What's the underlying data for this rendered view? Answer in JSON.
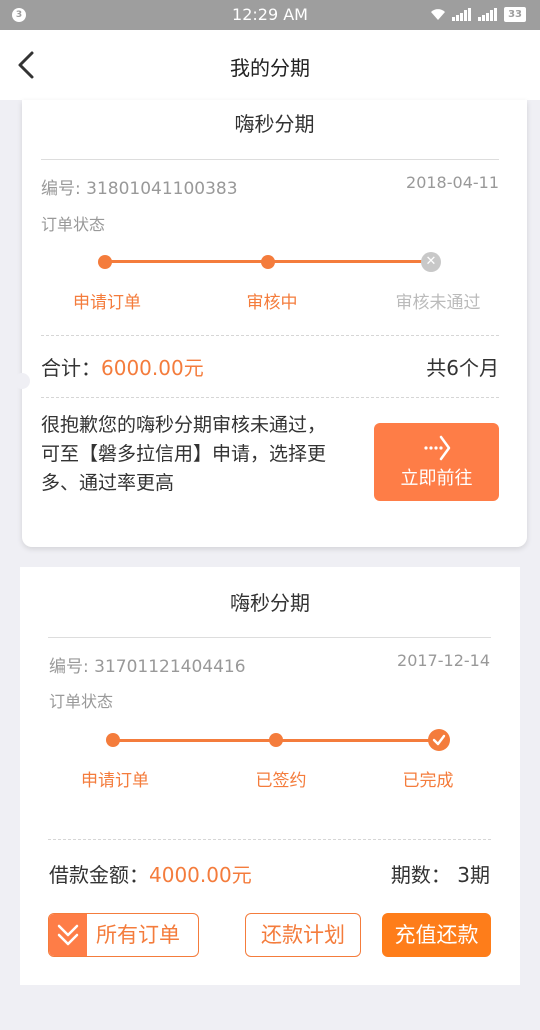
{
  "status_bar": {
    "notification_count": "3",
    "time": "12:29 AM",
    "battery": "33",
    "icons": [
      "wifi-icon",
      "signal-icon",
      "signal-icon",
      "battery-icon"
    ]
  },
  "header": {
    "title": "我的分期",
    "back_icon": "chevron-left-icon"
  },
  "orders": [
    {
      "title": "嗨秒分期",
      "order_no": "编号: 31801041100383",
      "date": "2018-04-11",
      "status_label": "订单状态",
      "steps": [
        {
          "label": "申请订单",
          "state": "done"
        },
        {
          "label": "审核中",
          "state": "done"
        },
        {
          "label": "审核未通过",
          "state": "failed"
        }
      ],
      "total_label": "合计：",
      "total_amount": "6000.00元",
      "months": "共6个月",
      "notice": "很抱歉您的嗨秒分期审核未通过，可至【磐多拉信用】申请，选择更多、通过率更高",
      "go_button": "立即前往",
      "go_icon": "arrow-right-icon"
    },
    {
      "title": "嗨秒分期",
      "order_no": "编号: 31701121404416",
      "date": "2017-12-14",
      "status_label": "订单状态",
      "steps": [
        {
          "label": "申请订单",
          "state": "done"
        },
        {
          "label": "已签约",
          "state": "done"
        },
        {
          "label": "已完成",
          "state": "complete"
        }
      ],
      "amount_label": "借款金额：",
      "amount": "4000.00元",
      "periods_label": "期数：",
      "periods": "3期",
      "buttons": {
        "all_orders": "所有订单",
        "all_orders_icon": "double-chevron-down-icon",
        "repay_plan": "还款计划",
        "recharge_repay": "充值还款"
      }
    }
  ],
  "colors": {
    "accent": "#f47c3c",
    "button_fill": "#fe7d47",
    "pay_button": "#fe7d1a",
    "muted": "#999999",
    "failed": "#c8c8c8",
    "background": "#efeff4",
    "status_bar": "#9e9e9e"
  }
}
